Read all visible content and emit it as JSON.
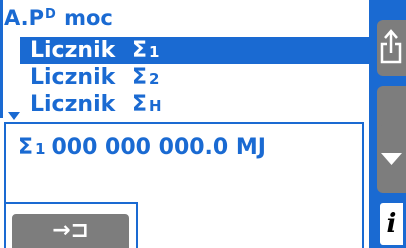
{
  "header": {
    "title_prefix": "A.P",
    "title_superscript": "D",
    "title_suffix": "moc"
  },
  "menu": {
    "items": [
      {
        "name": "Licznik",
        "sigma": "Σ",
        "sub": "1",
        "selected": true
      },
      {
        "name": "Licznik",
        "sigma": "Σ",
        "sub": "2",
        "selected": false
      },
      {
        "name": "Licznik",
        "sigma": "Σ",
        "sub": "H",
        "selected": false
      }
    ]
  },
  "value": {
    "sigma": "Σ",
    "sub": "1",
    "reading": "000 000 000.0 MJ"
  },
  "buttons": {
    "enter_glyph": "→⊐",
    "info_glyph": "i"
  },
  "icons": {
    "share": "share-icon",
    "down": "arrow-down-icon",
    "scroll": "scroll-down-indicator-icon"
  },
  "colors": {
    "accent": "#1a6ad2",
    "button": "#7d7d7d",
    "background": "#ffffff"
  }
}
